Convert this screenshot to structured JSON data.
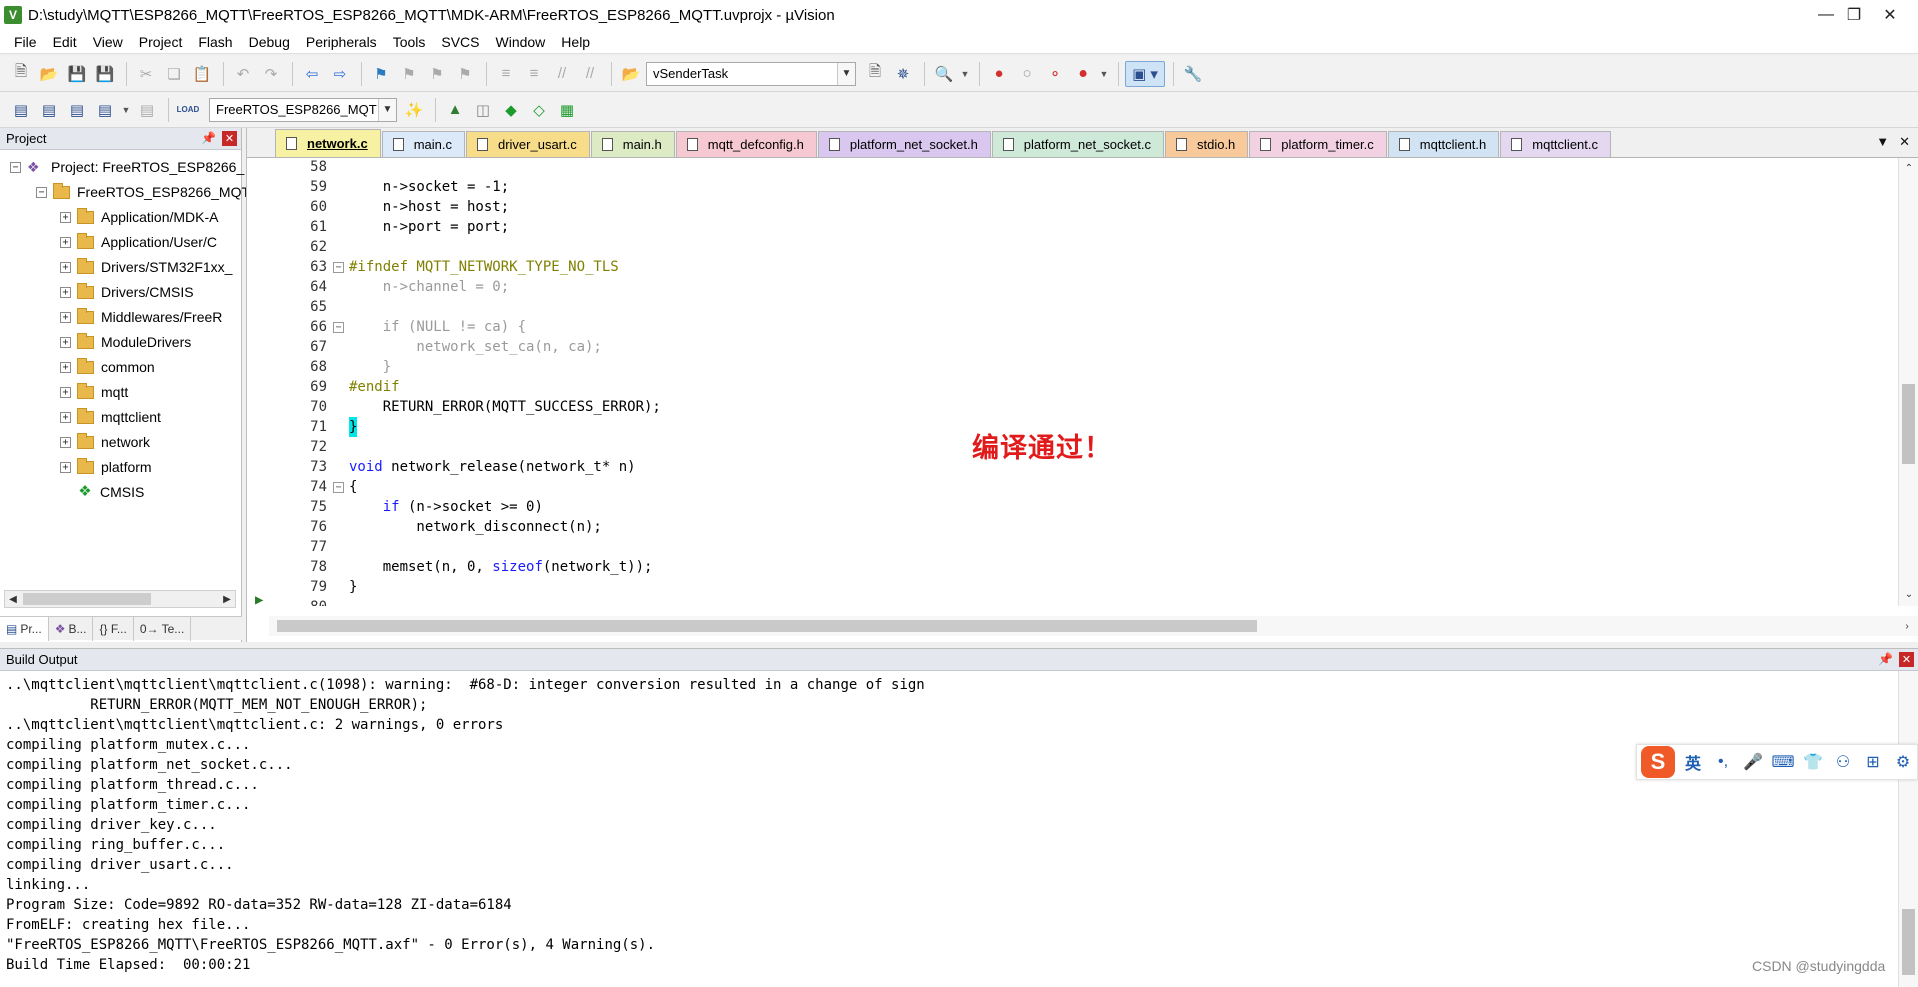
{
  "window": {
    "title": "D:\\study\\MQTT\\ESP8266_MQTT\\FreeRTOS_ESP8266_MQTT\\MDK-ARM\\FreeRTOS_ESP8266_MQTT.uvprojx - µVision",
    "app_icon": "V"
  },
  "menu": [
    "File",
    "Edit",
    "View",
    "Project",
    "Flash",
    "Debug",
    "Peripherals",
    "Tools",
    "SVCS",
    "Window",
    "Help"
  ],
  "toolbar1": {
    "task_combo": "vSenderTask"
  },
  "toolbar2": {
    "target_combo": "FreeRTOS_ESP8266_MQT",
    "load_label": "LOAD"
  },
  "project_panel": {
    "title": "Project",
    "root": "Project: FreeRTOS_ESP8266_",
    "target": "FreeRTOS_ESP8266_MQT",
    "groups": [
      "Application/MDK-A",
      "Application/User/C",
      "Drivers/STM32F1xx_",
      "Drivers/CMSIS",
      "Middlewares/FreeR",
      "ModuleDrivers",
      "common",
      "mqtt",
      "mqttclient",
      "network",
      "platform"
    ],
    "cmsis": "CMSIS",
    "tabs": [
      "Pr...",
      "B...",
      "{} F...",
      "0→ Te..."
    ]
  },
  "editor": {
    "tabs": [
      {
        "label": "network.c",
        "color": "#f7f1a3",
        "active": true
      },
      {
        "label": "main.c",
        "color": "#dbe9f8"
      },
      {
        "label": "driver_usart.c",
        "color": "#f7dd8a"
      },
      {
        "label": "main.h",
        "color": "#dcebc4"
      },
      {
        "label": "mqtt_defconfig.h",
        "color": "#f6c9d2"
      },
      {
        "label": "platform_net_socket.h",
        "color": "#d9c7ef"
      },
      {
        "label": "platform_net_socket.c",
        "color": "#cfe9d9"
      },
      {
        "label": "stdio.h",
        "color": "#f7c99b"
      },
      {
        "label": "platform_timer.c",
        "color": "#f2d2e2"
      },
      {
        "label": "mqttclient.h",
        "color": "#d2e3f3"
      },
      {
        "label": "mqttclient.c",
        "color": "#e3d8ef"
      }
    ],
    "lines": [
      {
        "n": "58",
        "text": ""
      },
      {
        "n": "59",
        "text": "    n->socket = -1;"
      },
      {
        "n": "60",
        "text": "    n->host = host;"
      },
      {
        "n": "61",
        "text": "    n->port = port;"
      },
      {
        "n": "62",
        "text": ""
      },
      {
        "n": "63",
        "text": "#ifndef MQTT_NETWORK_TYPE_NO_TLS",
        "fold": true
      },
      {
        "n": "64",
        "text": "    n->channel = 0;"
      },
      {
        "n": "65",
        "text": ""
      },
      {
        "n": "66",
        "text": "    if (NULL != ca) {",
        "fold": true
      },
      {
        "n": "67",
        "text": "        network_set_ca(n, ca);"
      },
      {
        "n": "68",
        "text": "    }"
      },
      {
        "n": "69",
        "text": "#endif"
      },
      {
        "n": "70",
        "text": "    RETURN_ERROR(MQTT_SUCCESS_ERROR);"
      },
      {
        "n": "71",
        "text": "}"
      },
      {
        "n": "72",
        "text": ""
      },
      {
        "n": "73",
        "text": "void network_release(network_t* n)"
      },
      {
        "n": "74",
        "text": "{",
        "fold": true
      },
      {
        "n": "75",
        "text": "    if (n->socket >= 0)"
      },
      {
        "n": "76",
        "text": "        network_disconnect(n);"
      },
      {
        "n": "77",
        "text": ""
      },
      {
        "n": "78",
        "text": "    memset(n, 0, sizeof(network_t));"
      },
      {
        "n": "79",
        "text": "}"
      },
      {
        "n": "80",
        "text": ""
      }
    ],
    "annotation": "编译通过！"
  },
  "build_output": {
    "title": "Build Output",
    "lines": [
      "..\\mqttclient\\mqttclient\\mqttclient.c(1098): warning:  #68-D: integer conversion resulted in a change of sign",
      "          RETURN_ERROR(MQTT_MEM_NOT_ENOUGH_ERROR);",
      "..\\mqttclient\\mqttclient\\mqttclient.c: 2 warnings, 0 errors",
      "compiling platform_mutex.c...",
      "compiling platform_net_socket.c...",
      "compiling platform_thread.c...",
      "compiling platform_timer.c...",
      "compiling driver_key.c...",
      "compiling ring_buffer.c...",
      "compiling driver_usart.c...",
      "linking...",
      "Program Size: Code=9892 RO-data=352 RW-data=128 ZI-data=6184",
      "FromELF: creating hex file...",
      "\"FreeRTOS_ESP8266_MQTT\\FreeRTOS_ESP8266_MQTT.axf\" - 0 Error(s), 4 Warning(s).",
      "Build Time Elapsed:  00:00:21"
    ]
  },
  "ime": {
    "logo": "S",
    "lang": "英",
    "punct": "•,",
    "items": [
      "🎤",
      "⌨",
      "👕",
      "⚇",
      "⊞",
      "⚙"
    ]
  },
  "watermark": "CSDN @studyingdda"
}
